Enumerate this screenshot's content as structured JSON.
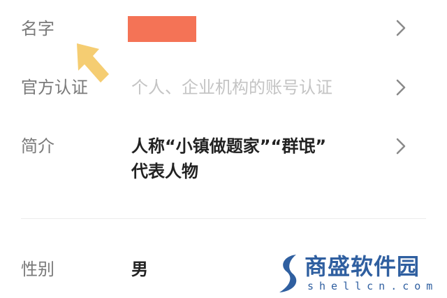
{
  "profile": {
    "name": {
      "label": "名字",
      "value_redacted": true
    },
    "verification": {
      "label": "官方认证",
      "placeholder": "个人、企业机构的账号认证"
    },
    "intro": {
      "label": "简介",
      "line1": "人称“小镇做题家”“群氓”",
      "line2": "代表人物"
    },
    "gender": {
      "label": "性别",
      "value": "男"
    }
  },
  "watermark": {
    "title": "商盛软件园",
    "domain": "shellcn.com"
  },
  "colors": {
    "label": "#7a7a7a",
    "value": "#222222",
    "placeholder": "#c4c4c4",
    "redaction": "#f47356",
    "arrow": "#f5cd72",
    "watermark": "#2f5fa0"
  },
  "icons": [
    "chevron-right-icon",
    "arrow-up-left-icon",
    "shellcn-logo-icon"
  ]
}
